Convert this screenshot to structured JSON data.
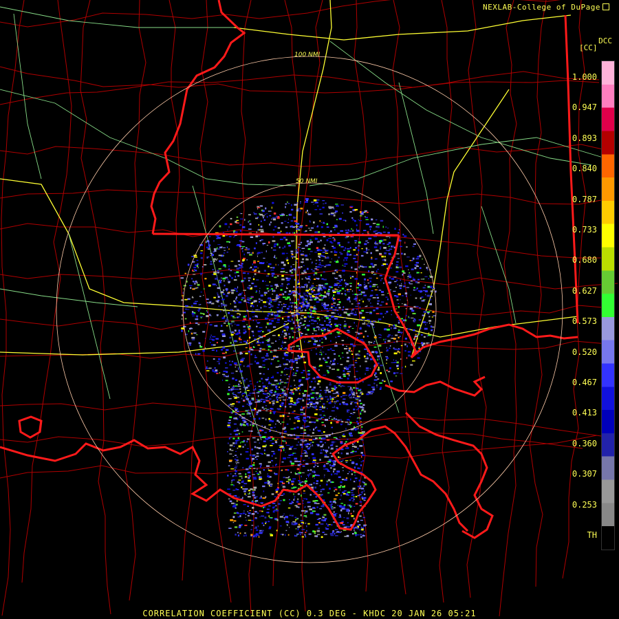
{
  "credit": "NEXLAB-College of DuPage",
  "product_code": "DCC",
  "unit": "[CC]",
  "title": "CORRELATION COEFFICIENT (CC) 0.3 DEG - KHDC 20 JAN 26 05:21",
  "range_rings": [
    "100 NMI",
    "50 NMI"
  ],
  "colorbar": {
    "labels": [
      "1.000",
      "0.947",
      "0.893",
      "0.840",
      "0.787",
      "0.733",
      "0.680",
      "0.627",
      "0.573",
      "0.520",
      "0.467",
      "0.413",
      "0.360",
      "0.307",
      "0.253",
      "TH"
    ],
    "colors": [
      "#ffb3d9",
      "#ff7fbf",
      "#e0004a",
      "#b40000",
      "#ff6600",
      "#ff9900",
      "#ffcc00",
      "#ffff00",
      "#bbdd00",
      "#66cc33",
      "#33ff33",
      "#9999dd",
      "#7777ee",
      "#3333ff",
      "#1111dd",
      "#0000bb",
      "#2222aa",
      "#7777aa",
      "#999999",
      "#888888",
      "#000000"
    ]
  },
  "colors": {
    "background": "#000000",
    "county_lines": "#b00000",
    "state_lines": "#ff1a1a",
    "highways_primary": "#ffff33",
    "highways_secondary": "#88dd88",
    "range_rings": "#ffccaa",
    "label_text": "#ffff55"
  }
}
